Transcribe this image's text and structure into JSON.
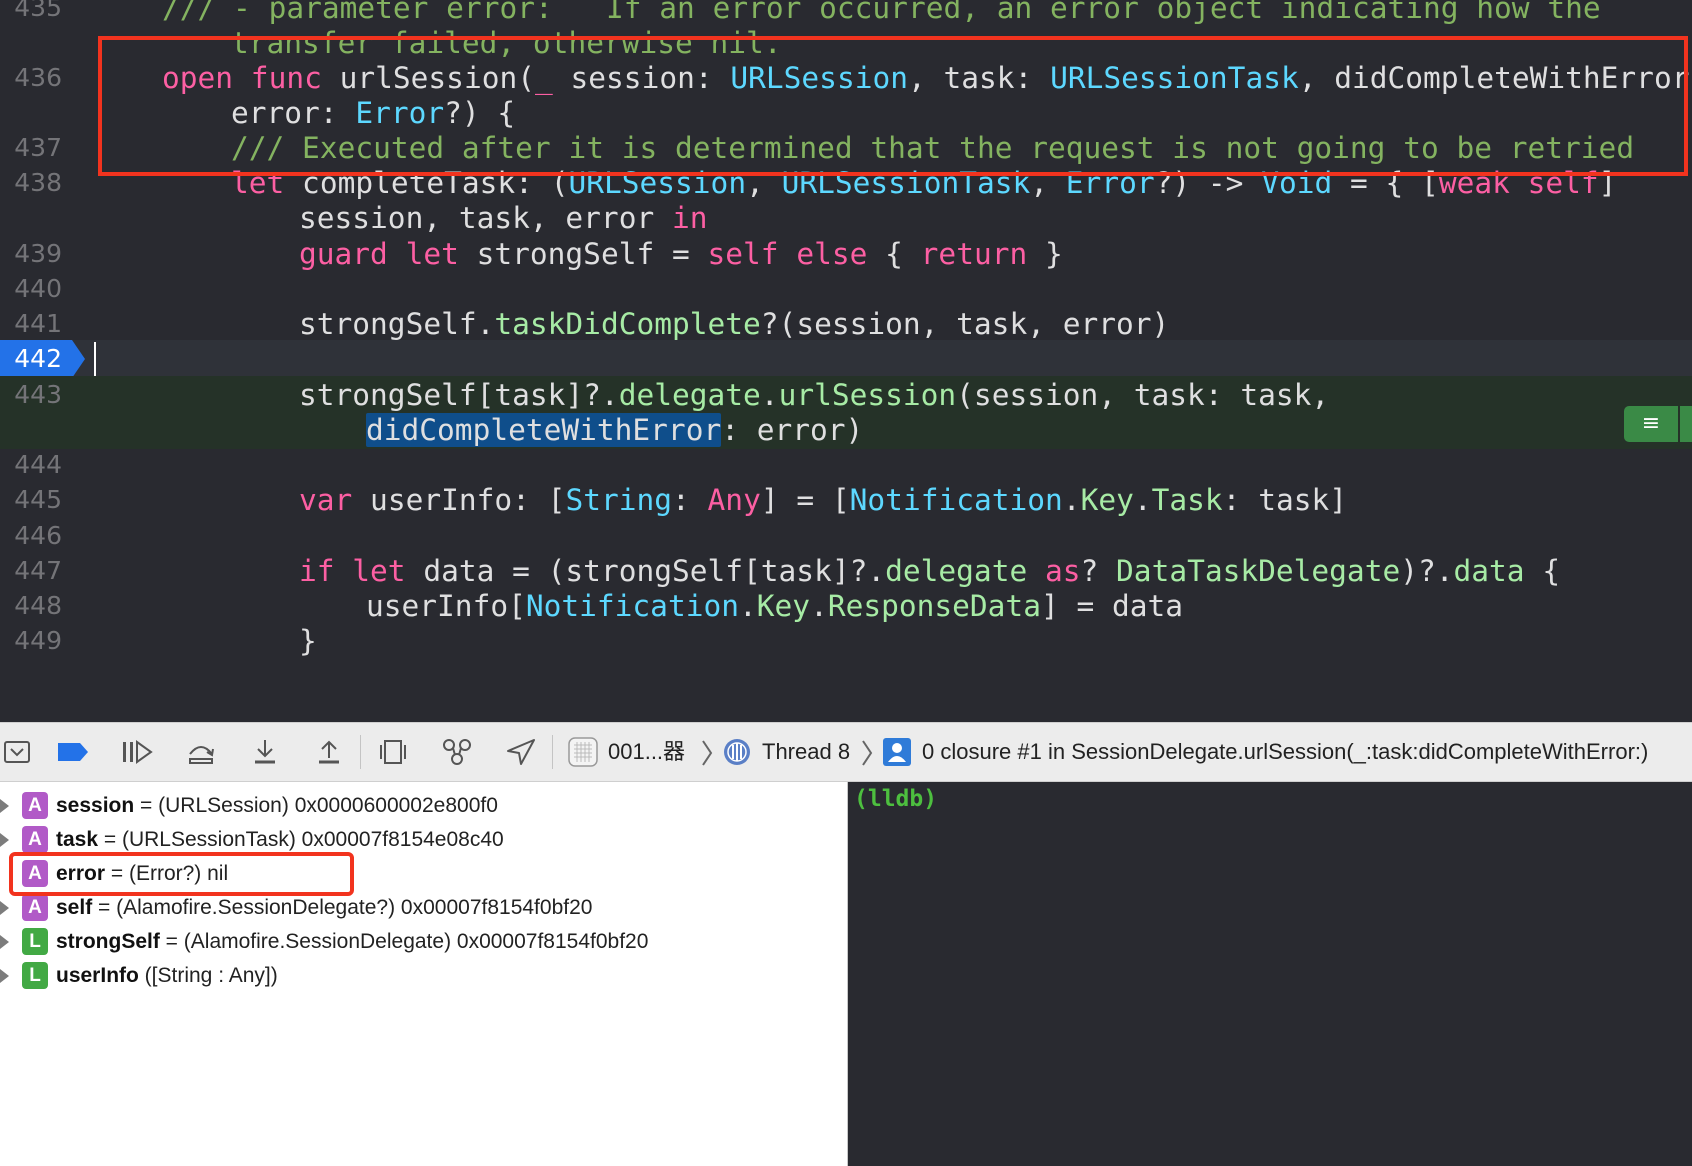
{
  "editor": {
    "lines": [
      {
        "id": "l435",
        "number": "435",
        "segments": [
          {
            "t": "/// - parameter error:   If an error occurred, an error object indicating how the",
            "c": "cm"
          }
        ]
      },
      {
        "id": "l435b",
        "number": "",
        "segments": [
          {
            "t": "transfer failed, otherwise nil.",
            "c": "cm"
          }
        ]
      },
      {
        "id": "l436",
        "number": "436",
        "segments": [
          {
            "t": "open func",
            "c": "kw"
          },
          {
            "t": " urlSession(",
            "c": ""
          },
          {
            "t": "_",
            "c": "kw"
          },
          {
            "t": " session: ",
            "c": ""
          },
          {
            "t": "URLSession",
            "c": "ty"
          },
          {
            "t": ", task: ",
            "c": ""
          },
          {
            "t": "URLSessionTask",
            "c": "ty"
          },
          {
            "t": ", didCompleteWithError",
            "c": ""
          }
        ]
      },
      {
        "id": "l436b",
        "number": "",
        "segments": [
          {
            "t": "error: ",
            "c": ""
          },
          {
            "t": "Error",
            "c": "ty"
          },
          {
            "t": "?) {",
            "c": ""
          }
        ]
      },
      {
        "id": "l437",
        "number": "437",
        "segments": [
          {
            "t": "/// Executed after it is determined that the request is not going to be retried",
            "c": "cm"
          }
        ]
      },
      {
        "id": "l438",
        "number": "438",
        "segments": [
          {
            "t": "let",
            "c": "kw"
          },
          {
            "t": " completeTask: (",
            "c": ""
          },
          {
            "t": "URLSession",
            "c": "ty"
          },
          {
            "t": ", ",
            "c": ""
          },
          {
            "t": "URLSessionTask",
            "c": "ty"
          },
          {
            "t": ", ",
            "c": ""
          },
          {
            "t": "Error",
            "c": "ty"
          },
          {
            "t": "?) -> ",
            "c": ""
          },
          {
            "t": "Void",
            "c": "ty"
          },
          {
            "t": " = { [",
            "c": ""
          },
          {
            "t": "weak self",
            "c": "kw"
          },
          {
            "t": "]",
            "c": ""
          }
        ]
      },
      {
        "id": "l438b",
        "number": "",
        "segments": [
          {
            "t": "session, task, error ",
            "c": ""
          },
          {
            "t": "in",
            "c": "kw"
          }
        ]
      },
      {
        "id": "l439",
        "number": "439",
        "segments": [
          {
            "t": "guard let",
            "c": "kw"
          },
          {
            "t": " strongSelf = ",
            "c": ""
          },
          {
            "t": "self else",
            "c": "kw"
          },
          {
            "t": " { ",
            "c": ""
          },
          {
            "t": "return",
            "c": "kw"
          },
          {
            "t": " }",
            "c": ""
          }
        ]
      },
      {
        "id": "l440",
        "number": "440",
        "segments": []
      },
      {
        "id": "l441",
        "number": "441",
        "segments": [
          {
            "t": "strongSelf.",
            "c": ""
          },
          {
            "t": "taskDidComplete",
            "c": "pr"
          },
          {
            "t": "?(session, task, error)",
            "c": ""
          }
        ]
      },
      {
        "id": "l442",
        "number": "442",
        "segments": []
      },
      {
        "id": "l443",
        "number": "443",
        "segments": [
          {
            "t": "strongSelf[task]?.",
            "c": ""
          },
          {
            "t": "delegate",
            "c": "pr"
          },
          {
            "t": ".",
            "c": ""
          },
          {
            "t": "urlSession",
            "c": "pr"
          },
          {
            "t": "(session, task: task,",
            "c": ""
          }
        ]
      },
      {
        "id": "l443b",
        "number": "",
        "segments": [
          {
            "t": "didCompleteWithError",
            "c": "hi"
          },
          {
            "t": ": error)",
            "c": ""
          }
        ]
      },
      {
        "id": "l444",
        "number": "444",
        "segments": []
      },
      {
        "id": "l445",
        "number": "445",
        "segments": [
          {
            "t": "var",
            "c": "kw"
          },
          {
            "t": " userInfo: [",
            "c": ""
          },
          {
            "t": "String",
            "c": "ty"
          },
          {
            "t": ": ",
            "c": ""
          },
          {
            "t": "Any",
            "c": "kw"
          },
          {
            "t": "] = [",
            "c": ""
          },
          {
            "t": "Notification",
            "c": "ty"
          },
          {
            "t": ".",
            "c": ""
          },
          {
            "t": "Key",
            "c": "pr"
          },
          {
            "t": ".",
            "c": ""
          },
          {
            "t": "Task",
            "c": "pr"
          },
          {
            "t": ": task]",
            "c": ""
          }
        ]
      },
      {
        "id": "l446",
        "number": "446",
        "segments": []
      },
      {
        "id": "l447",
        "number": "447",
        "segments": [
          {
            "t": "if let",
            "c": "kw"
          },
          {
            "t": " data = (strongSelf[task]?.",
            "c": ""
          },
          {
            "t": "delegate",
            "c": "pr"
          },
          {
            "t": " as",
            "c": "kw"
          },
          {
            "t": "? ",
            "c": ""
          },
          {
            "t": "DataTaskDelegate",
            "c": "pr"
          },
          {
            "t": ")?.",
            "c": ""
          },
          {
            "t": "data",
            "c": "pr"
          },
          {
            "t": " {",
            "c": ""
          }
        ]
      },
      {
        "id": "l448",
        "number": "448",
        "segments": [
          {
            "t": "userInfo[",
            "c": ""
          },
          {
            "t": "Notification",
            "c": "ty"
          },
          {
            "t": ".",
            "c": ""
          },
          {
            "t": "Key",
            "c": "pr"
          },
          {
            "t": ".",
            "c": ""
          },
          {
            "t": "ResponseData",
            "c": "pr"
          },
          {
            "t": "] = data",
            "c": ""
          }
        ]
      },
      {
        "id": "l449",
        "number": "449",
        "segments": [
          {
            "t": "}",
            "c": ""
          }
        ]
      }
    ],
    "issue_icon": "list-icon"
  },
  "debug_bar": {
    "icons": [
      "hide-debug-area-icon",
      "breakpoints-toggle-icon",
      "continue-icon",
      "step-over-icon",
      "step-into-icon",
      "step-out-icon",
      "view-hierarchy-icon",
      "memory-graph-icon",
      "simulate-location-icon"
    ],
    "process": "001...器",
    "thread": "Thread 8",
    "frame": "0 closure #1 in SessionDelegate.urlSession(_:task:didCompleteWithError:)"
  },
  "variables": [
    {
      "badge": "A",
      "name": "session",
      "rest": " = (URLSession) 0x0000600002e800f0",
      "expandable": true
    },
    {
      "badge": "A",
      "name": "task",
      "rest": " = (URLSessionTask) 0x00007f8154e08c40",
      "expandable": true
    },
    {
      "badge": "A",
      "name": "error",
      "rest": " = (Error?) nil",
      "expandable": false
    },
    {
      "badge": "A",
      "name": "self",
      "rest": " = (Alamofire.SessionDelegate?) 0x00007f8154f0bf20",
      "expandable": true
    },
    {
      "badge": "L",
      "name": "strongSelf",
      "rest": " = (Alamofire.SessionDelegate) 0x00007f8154f0bf20",
      "expandable": true
    },
    {
      "badge": "L",
      "name": "userInfo",
      "rest": " ([String : Any])",
      "expandable": true
    }
  ],
  "console": {
    "prompt": "(lldb)"
  },
  "colors": {
    "editor_bg": "#292a30",
    "keyword": "#fc5fa3",
    "type": "#5dd8ff",
    "property": "#a7eba5",
    "comment": "#84b360",
    "breakpoint": "#2372e8",
    "annotation_box": "#f2331e",
    "console_prompt": "#4dbf3f"
  }
}
